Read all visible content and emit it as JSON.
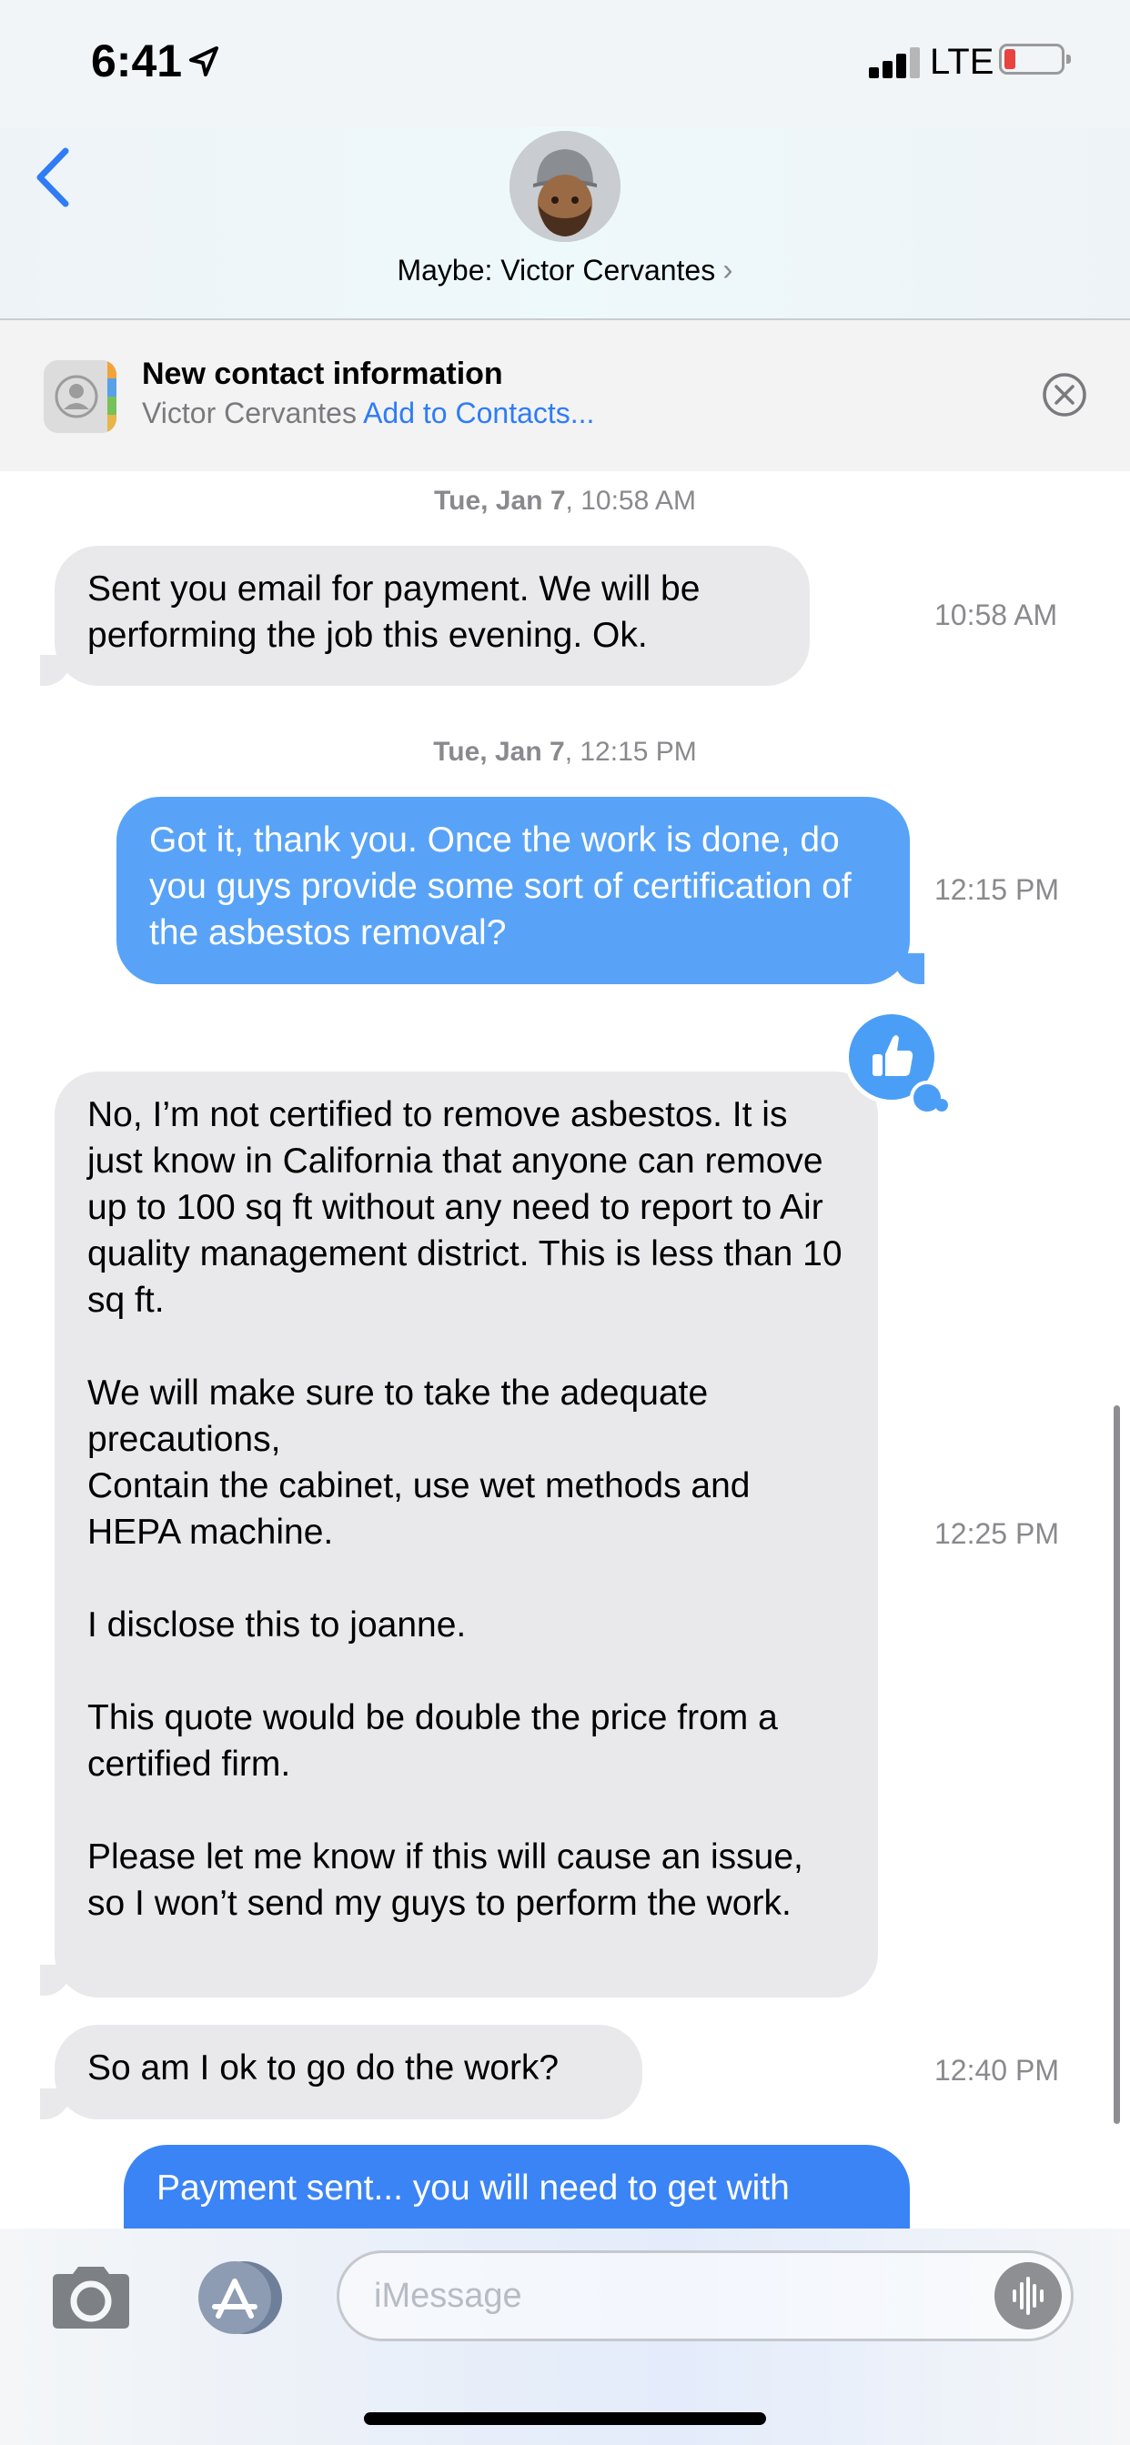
{
  "status": {
    "time": "6:41",
    "network": "LTE"
  },
  "header": {
    "contact_name": "Maybe: Victor Cervantes",
    "chevron": "›"
  },
  "banner": {
    "title": "New contact information",
    "name": "Victor Cervantes",
    "action": "Add to Contacts..."
  },
  "thread": {
    "ts1_day": "Tue, Jan 7",
    "ts1_time": ", 10:58 AM",
    "msg1": "Sent you email for payment. We will be performing the job this evening. Ok.",
    "msg1_time": "10:58 AM",
    "ts2_day": "Tue, Jan 7",
    "ts2_time": ", 12:15 PM",
    "msg2": "Got it, thank you. Once the work is done, do you guys provide some sort of certification of the asbestos removal?",
    "msg2_time": "12:15 PM",
    "msg3": "No, I’m not certified to remove asbestos. It is just know in California that anyone can remove up to 100 sq ft without any need to report to Air quality management district. This is less than 10 sq ft.\n\nWe will make sure to take the adequate precautions,\nContain the cabinet, use wet methods and HEPA machine.\n\nI disclose this to joanne.\n\nThis quote would be double the price from a certified firm.\n\nPlease let me know if this will cause an issue, so I won’t send my guys to perform the work.",
    "msg3_time": "12:25 PM",
    "msg4": "So am I ok to go do the work?",
    "msg4_time": "12:40 PM",
    "msg5": "Payment sent... you will need to get with"
  },
  "composer": {
    "placeholder": "iMessage"
  },
  "colors": {
    "accent": "#2f7cf6",
    "sent_bubble": "#58a3f7",
    "received_bubble": "#e9e9eb"
  },
  "icons": [
    "location-arrow-icon",
    "signal-icon",
    "battery-icon",
    "back-chevron-icon",
    "contacts-icon",
    "close-icon",
    "thumbs-up-icon",
    "camera-icon",
    "app-store-icon",
    "audio-waveform-icon"
  ]
}
